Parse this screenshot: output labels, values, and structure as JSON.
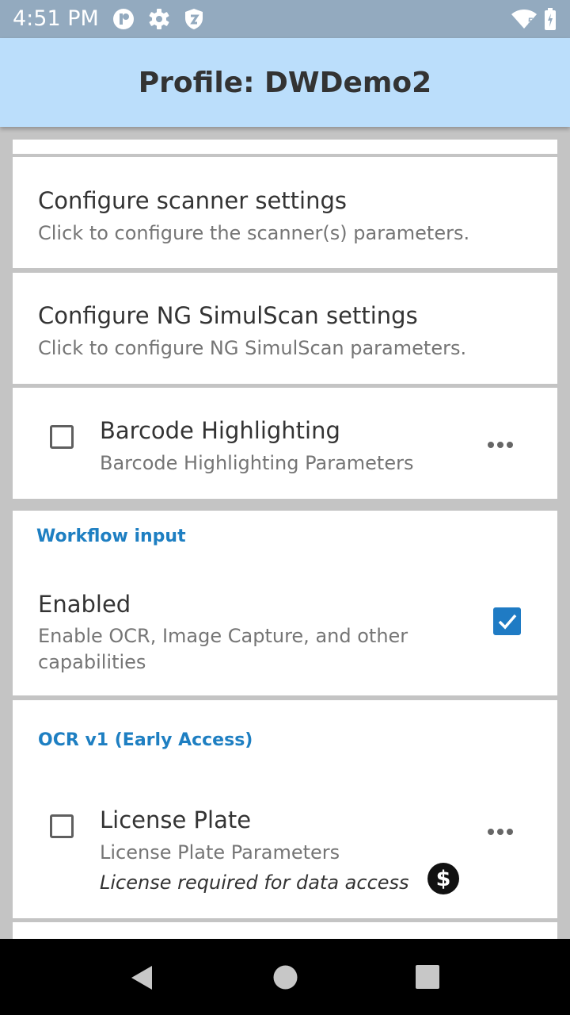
{
  "status_bar": {
    "time": "4:51 PM",
    "network_badge": "5",
    "icons": [
      "at-icon",
      "gear-icon",
      "shield-icon",
      "wifi-icon",
      "battery-icon"
    ]
  },
  "app_bar": {
    "title": "Profile: DWDemo2"
  },
  "items": {
    "scanner": {
      "title": "Configure scanner settings",
      "subtitle": "Click to configure the scanner(s) parameters."
    },
    "simulscan": {
      "title": "Configure NG SimulScan settings",
      "subtitle": "Click to configure NG SimulScan parameters."
    },
    "barcode_highlighting": {
      "title": "Barcode Highlighting",
      "subtitle": "Barcode Highlighting Parameters",
      "checked": false
    }
  },
  "workflow": {
    "header": "Workflow input",
    "enabled_title": "Enabled",
    "enabled_sub_line1": "Enable OCR, Image Capture, and other",
    "enabled_sub_line2": "capabilities",
    "checked": true
  },
  "ocr": {
    "header": "OCR v1 (Early Access)",
    "license_plate_title": "License Plate",
    "license_plate_sub": "License Plate Parameters",
    "license_note": "License required for data access",
    "checked": false
  },
  "colors": {
    "accent": "#1e7fc2",
    "app_bar": "#bbdefb",
    "status_bar": "#93aabf",
    "checkbox_checked": "#1f7bc4"
  }
}
